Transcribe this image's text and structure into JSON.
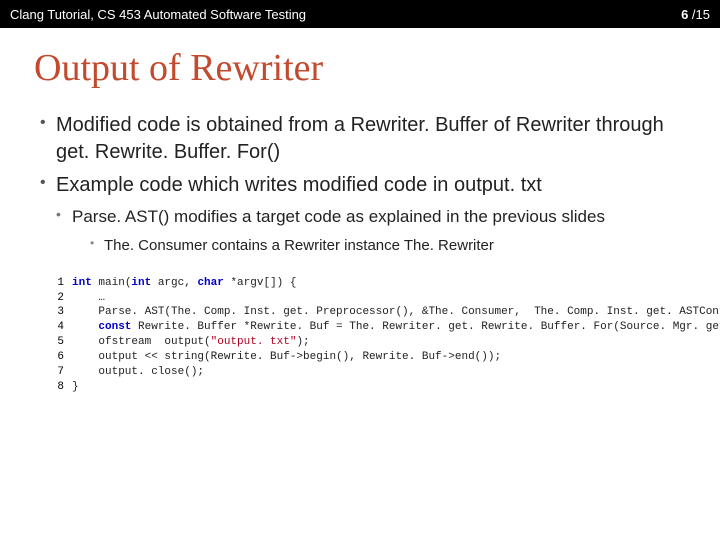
{
  "header": {
    "left": "Clang Tutorial, CS 453 Automated Software Testing",
    "page_current": "6",
    "page_sep": " /",
    "page_total": "15"
  },
  "title": "Output of Rewriter",
  "bullets": {
    "b1_a": "Modified code is obtained from a ",
    "b1_b": "Rewriter. Buffer",
    "b1_c": " of ",
    "b1_d": "Rewriter",
    "b1_e": " through ",
    "b1_f": "get. Rewrite. Buffer. For()",
    "b2_a": "Example code which writes modified code in ",
    "b2_b": "output. txt",
    "b3_a": "Parse. AST()",
    "b3_b": " modifies a target code as explained in the previous slides",
    "b4_a": "The. Consumer",
    "b4_b": " contains a ",
    "b4_c": "Rewriter",
    "b4_d": " instance ",
    "b4_e": "The. Rewriter"
  },
  "code": {
    "ln1": "1",
    "ln2": "2",
    "ln3": "3",
    "ln4": "4",
    "ln5": "5",
    "ln6": "6",
    "ln7": "7",
    "ln8": "8",
    "l1_a": "int",
    "l1_b": " main(",
    "l1_c": "int",
    "l1_d": " argc, ",
    "l1_e": "char",
    "l1_f": " *argv[]) {",
    "l2": "    …",
    "l3": "    Parse. AST(The. Comp. Inst. get. Preprocessor(), &The. Consumer,  The. Comp. Inst. get. ASTContext());",
    "l4_a": "    ",
    "l4_b": "const",
    "l4_c": " Rewrite. Buffer *Rewrite. Buf = The. Rewriter. get. Rewrite. Buffer. For(Source. Mgr. get. Main. File. ID());",
    "l5_a": "    ofstream  output(",
    "l5_b": "\"output. txt\"",
    "l5_c": ");",
    "l6": "    output << string(Rewrite. Buf->begin(), Rewrite. Buf->end());",
    "l7": "    output. close();",
    "l8": "}"
  }
}
